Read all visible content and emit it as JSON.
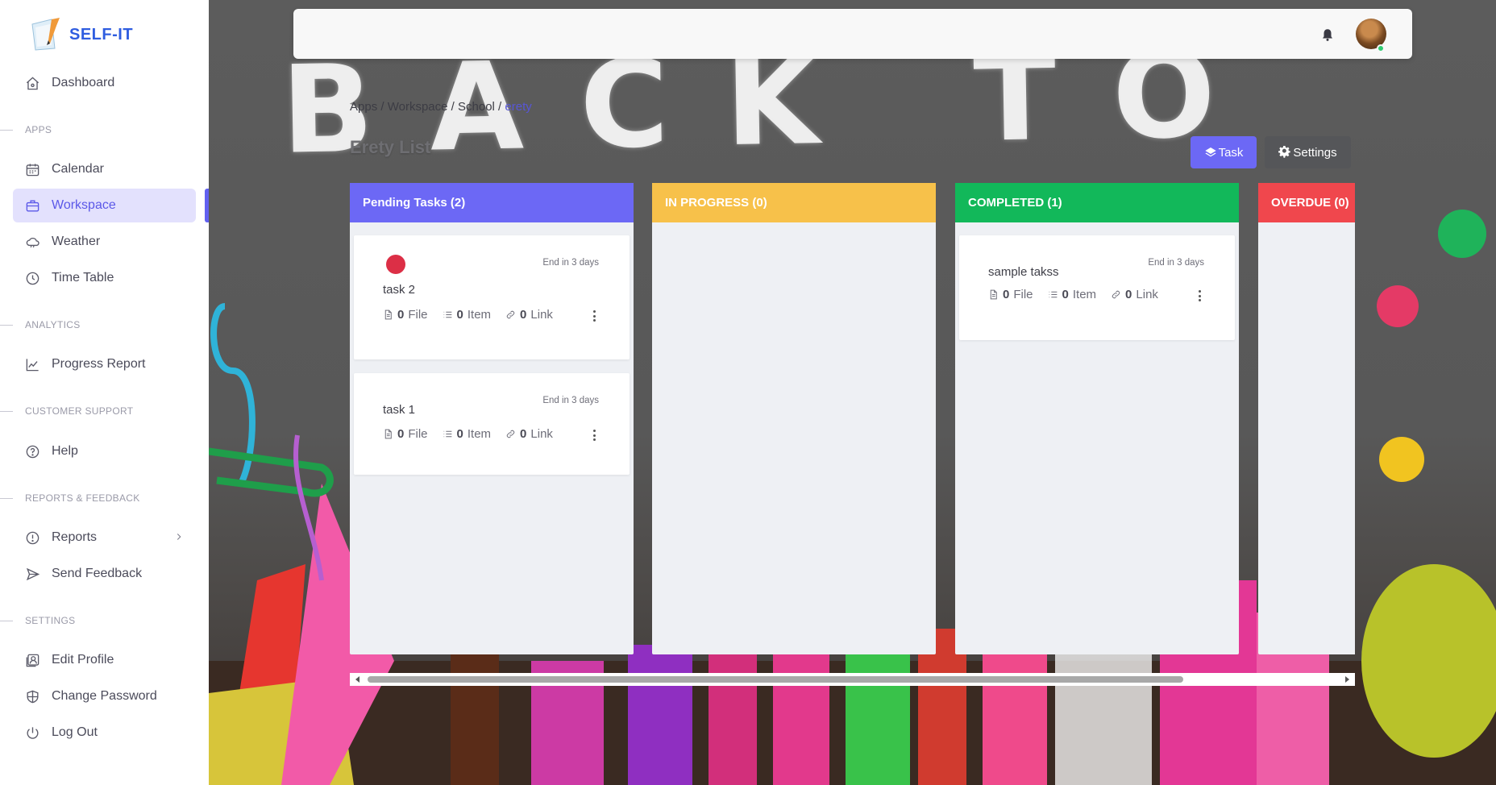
{
  "app": {
    "name": "SELF-IT"
  },
  "sidebar": {
    "dashboard": "Dashboard",
    "sections": {
      "apps": "APPS",
      "analytics": "ANALYTICS",
      "support": "CUSTOMER SUPPORT",
      "reports": "REPORTS & FEEDBACK",
      "settings": "SETTINGS"
    },
    "items": {
      "calendar": "Calendar",
      "workspace": "Workspace",
      "weather": "Weather",
      "timetable": "Time Table",
      "progress": "Progress Report",
      "help": "Help",
      "reports": "Reports",
      "feedback": "Send Feedback",
      "edit_profile": "Edit Profile",
      "change_password": "Change Password",
      "logout": "Log Out"
    },
    "active": "Workspace"
  },
  "background": {
    "chalk_text": "BACK TO"
  },
  "breadcrumb": {
    "apps": "Apps",
    "sep": " / ",
    "workspace": "Workspace",
    "school": "School",
    "current": "erety"
  },
  "page": {
    "title": "Erety List"
  },
  "buttons": {
    "task": "Task",
    "settings": "Settings"
  },
  "board": {
    "columns": [
      {
        "title": "Pending Tasks (2)",
        "color": "#6c68f5"
      },
      {
        "title": "IN PROGRESS (0)",
        "color": "#f7c14a"
      },
      {
        "title": "COMPLETED (1)",
        "color": "#12b85a"
      },
      {
        "title": "OVERDUE (0)",
        "color": "#f0474d"
      }
    ],
    "cards": {
      "task2": {
        "name": "task 2",
        "due": "End in 3 days",
        "files": "0",
        "items": "0",
        "links": "0",
        "priority_color": "#dc2f46"
      },
      "task1": {
        "name": "task 1",
        "due": "End in 3 days",
        "files": "0",
        "items": "0",
        "links": "0"
      },
      "sample": {
        "name": "sample takss",
        "due": "End in 3 days",
        "files": "0",
        "items": "0",
        "links": "0"
      }
    },
    "labels": {
      "file": "File",
      "item": "Item",
      "link": "Link"
    }
  }
}
